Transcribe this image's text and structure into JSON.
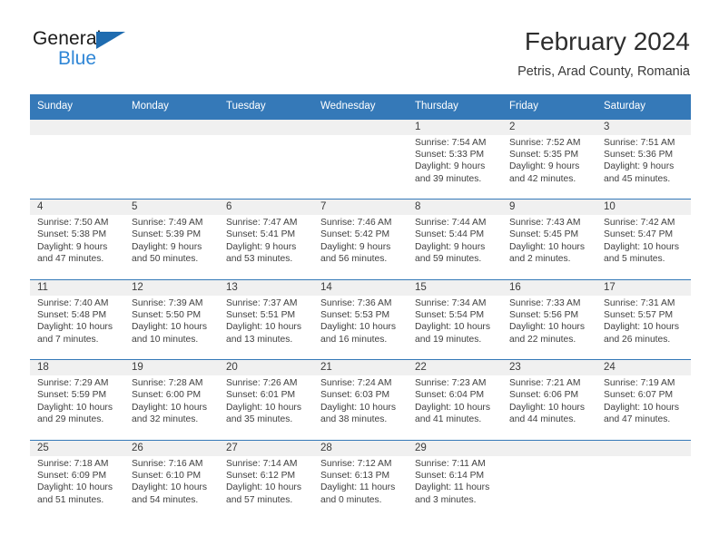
{
  "brand": {
    "name_part1": "General",
    "name_part2": "Blue",
    "triangle_color": "#1f6cb0",
    "blue_color": "#2f86d6"
  },
  "header": {
    "title": "February 2024",
    "subtitle": "Petris, Arad County, Romania"
  },
  "theme": {
    "header_bar_color": "#3579b8",
    "daynum_band_color": "#f0f0f0",
    "row_border_color": "#3579b8",
    "text_color": "#404040"
  },
  "weekdays": [
    "Sunday",
    "Monday",
    "Tuesday",
    "Wednesday",
    "Thursday",
    "Friday",
    "Saturday"
  ],
  "weeks": [
    [
      {
        "day": "",
        "sunrise": "",
        "sunset": "",
        "daylight_line1": "",
        "daylight_line2": ""
      },
      {
        "day": "",
        "sunrise": "",
        "sunset": "",
        "daylight_line1": "",
        "daylight_line2": ""
      },
      {
        "day": "",
        "sunrise": "",
        "sunset": "",
        "daylight_line1": "",
        "daylight_line2": ""
      },
      {
        "day": "",
        "sunrise": "",
        "sunset": "",
        "daylight_line1": "",
        "daylight_line2": ""
      },
      {
        "day": "1",
        "sunrise": "Sunrise: 7:54 AM",
        "sunset": "Sunset: 5:33 PM",
        "daylight_line1": "Daylight: 9 hours",
        "daylight_line2": "and 39 minutes."
      },
      {
        "day": "2",
        "sunrise": "Sunrise: 7:52 AM",
        "sunset": "Sunset: 5:35 PM",
        "daylight_line1": "Daylight: 9 hours",
        "daylight_line2": "and 42 minutes."
      },
      {
        "day": "3",
        "sunrise": "Sunrise: 7:51 AM",
        "sunset": "Sunset: 5:36 PM",
        "daylight_line1": "Daylight: 9 hours",
        "daylight_line2": "and 45 minutes."
      }
    ],
    [
      {
        "day": "4",
        "sunrise": "Sunrise: 7:50 AM",
        "sunset": "Sunset: 5:38 PM",
        "daylight_line1": "Daylight: 9 hours",
        "daylight_line2": "and 47 minutes."
      },
      {
        "day": "5",
        "sunrise": "Sunrise: 7:49 AM",
        "sunset": "Sunset: 5:39 PM",
        "daylight_line1": "Daylight: 9 hours",
        "daylight_line2": "and 50 minutes."
      },
      {
        "day": "6",
        "sunrise": "Sunrise: 7:47 AM",
        "sunset": "Sunset: 5:41 PM",
        "daylight_line1": "Daylight: 9 hours",
        "daylight_line2": "and 53 minutes."
      },
      {
        "day": "7",
        "sunrise": "Sunrise: 7:46 AM",
        "sunset": "Sunset: 5:42 PM",
        "daylight_line1": "Daylight: 9 hours",
        "daylight_line2": "and 56 minutes."
      },
      {
        "day": "8",
        "sunrise": "Sunrise: 7:44 AM",
        "sunset": "Sunset: 5:44 PM",
        "daylight_line1": "Daylight: 9 hours",
        "daylight_line2": "and 59 minutes."
      },
      {
        "day": "9",
        "sunrise": "Sunrise: 7:43 AM",
        "sunset": "Sunset: 5:45 PM",
        "daylight_line1": "Daylight: 10 hours",
        "daylight_line2": "and 2 minutes."
      },
      {
        "day": "10",
        "sunrise": "Sunrise: 7:42 AM",
        "sunset": "Sunset: 5:47 PM",
        "daylight_line1": "Daylight: 10 hours",
        "daylight_line2": "and 5 minutes."
      }
    ],
    [
      {
        "day": "11",
        "sunrise": "Sunrise: 7:40 AM",
        "sunset": "Sunset: 5:48 PM",
        "daylight_line1": "Daylight: 10 hours",
        "daylight_line2": "and 7 minutes."
      },
      {
        "day": "12",
        "sunrise": "Sunrise: 7:39 AM",
        "sunset": "Sunset: 5:50 PM",
        "daylight_line1": "Daylight: 10 hours",
        "daylight_line2": "and 10 minutes."
      },
      {
        "day": "13",
        "sunrise": "Sunrise: 7:37 AM",
        "sunset": "Sunset: 5:51 PM",
        "daylight_line1": "Daylight: 10 hours",
        "daylight_line2": "and 13 minutes."
      },
      {
        "day": "14",
        "sunrise": "Sunrise: 7:36 AM",
        "sunset": "Sunset: 5:53 PM",
        "daylight_line1": "Daylight: 10 hours",
        "daylight_line2": "and 16 minutes."
      },
      {
        "day": "15",
        "sunrise": "Sunrise: 7:34 AM",
        "sunset": "Sunset: 5:54 PM",
        "daylight_line1": "Daylight: 10 hours",
        "daylight_line2": "and 19 minutes."
      },
      {
        "day": "16",
        "sunrise": "Sunrise: 7:33 AM",
        "sunset": "Sunset: 5:56 PM",
        "daylight_line1": "Daylight: 10 hours",
        "daylight_line2": "and 22 minutes."
      },
      {
        "day": "17",
        "sunrise": "Sunrise: 7:31 AM",
        "sunset": "Sunset: 5:57 PM",
        "daylight_line1": "Daylight: 10 hours",
        "daylight_line2": "and 26 minutes."
      }
    ],
    [
      {
        "day": "18",
        "sunrise": "Sunrise: 7:29 AM",
        "sunset": "Sunset: 5:59 PM",
        "daylight_line1": "Daylight: 10 hours",
        "daylight_line2": "and 29 minutes."
      },
      {
        "day": "19",
        "sunrise": "Sunrise: 7:28 AM",
        "sunset": "Sunset: 6:00 PM",
        "daylight_line1": "Daylight: 10 hours",
        "daylight_line2": "and 32 minutes."
      },
      {
        "day": "20",
        "sunrise": "Sunrise: 7:26 AM",
        "sunset": "Sunset: 6:01 PM",
        "daylight_line1": "Daylight: 10 hours",
        "daylight_line2": "and 35 minutes."
      },
      {
        "day": "21",
        "sunrise": "Sunrise: 7:24 AM",
        "sunset": "Sunset: 6:03 PM",
        "daylight_line1": "Daylight: 10 hours",
        "daylight_line2": "and 38 minutes."
      },
      {
        "day": "22",
        "sunrise": "Sunrise: 7:23 AM",
        "sunset": "Sunset: 6:04 PM",
        "daylight_line1": "Daylight: 10 hours",
        "daylight_line2": "and 41 minutes."
      },
      {
        "day": "23",
        "sunrise": "Sunrise: 7:21 AM",
        "sunset": "Sunset: 6:06 PM",
        "daylight_line1": "Daylight: 10 hours",
        "daylight_line2": "and 44 minutes."
      },
      {
        "day": "24",
        "sunrise": "Sunrise: 7:19 AM",
        "sunset": "Sunset: 6:07 PM",
        "daylight_line1": "Daylight: 10 hours",
        "daylight_line2": "and 47 minutes."
      }
    ],
    [
      {
        "day": "25",
        "sunrise": "Sunrise: 7:18 AM",
        "sunset": "Sunset: 6:09 PM",
        "daylight_line1": "Daylight: 10 hours",
        "daylight_line2": "and 51 minutes."
      },
      {
        "day": "26",
        "sunrise": "Sunrise: 7:16 AM",
        "sunset": "Sunset: 6:10 PM",
        "daylight_line1": "Daylight: 10 hours",
        "daylight_line2": "and 54 minutes."
      },
      {
        "day": "27",
        "sunrise": "Sunrise: 7:14 AM",
        "sunset": "Sunset: 6:12 PM",
        "daylight_line1": "Daylight: 10 hours",
        "daylight_line2": "and 57 minutes."
      },
      {
        "day": "28",
        "sunrise": "Sunrise: 7:12 AM",
        "sunset": "Sunset: 6:13 PM",
        "daylight_line1": "Daylight: 11 hours",
        "daylight_line2": "and 0 minutes."
      },
      {
        "day": "29",
        "sunrise": "Sunrise: 7:11 AM",
        "sunset": "Sunset: 6:14 PM",
        "daylight_line1": "Daylight: 11 hours",
        "daylight_line2": "and 3 minutes."
      },
      {
        "day": "",
        "sunrise": "",
        "sunset": "",
        "daylight_line1": "",
        "daylight_line2": ""
      },
      {
        "day": "",
        "sunrise": "",
        "sunset": "",
        "daylight_line1": "",
        "daylight_line2": ""
      }
    ]
  ]
}
